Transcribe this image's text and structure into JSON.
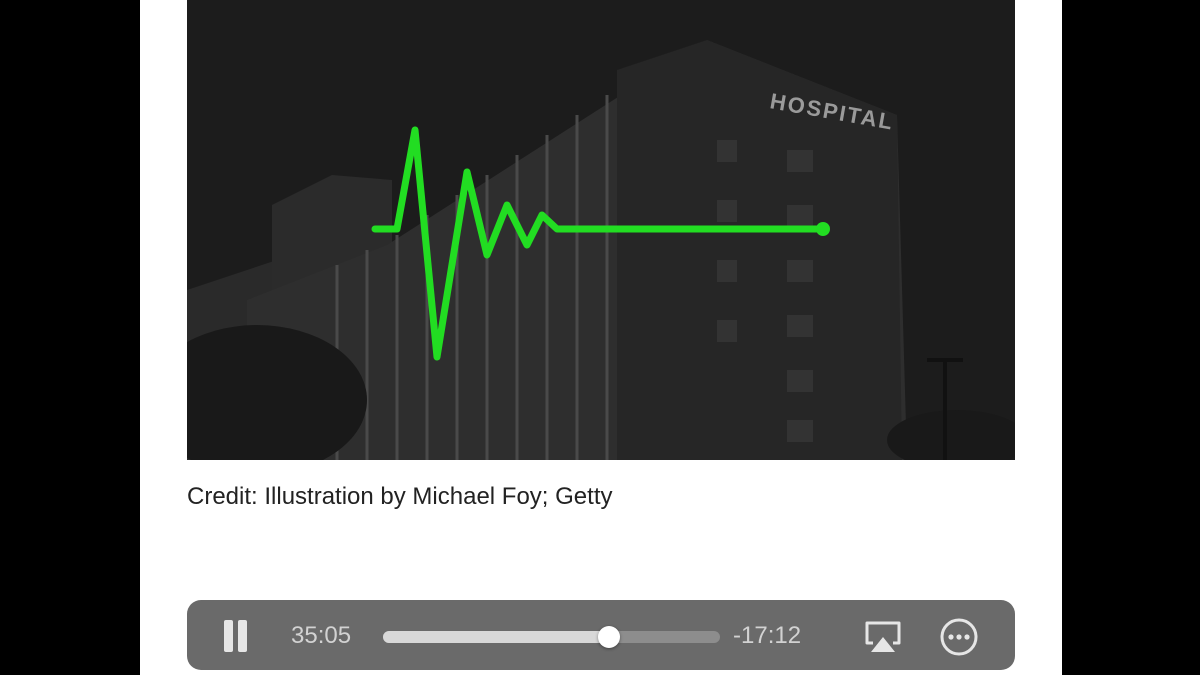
{
  "hero": {
    "sign_text": "HOSPITAL",
    "pulse_color": "#22dd22"
  },
  "caption": {
    "credit": "Credit: Illustration by Michael Foy; Getty"
  },
  "player": {
    "elapsed": "35:05",
    "remaining": "-17:12",
    "progress_fraction": 0.6712,
    "pause_icon": "pause-icon",
    "airplay_icon": "airplay-icon",
    "more_icon": "more-options-icon"
  }
}
